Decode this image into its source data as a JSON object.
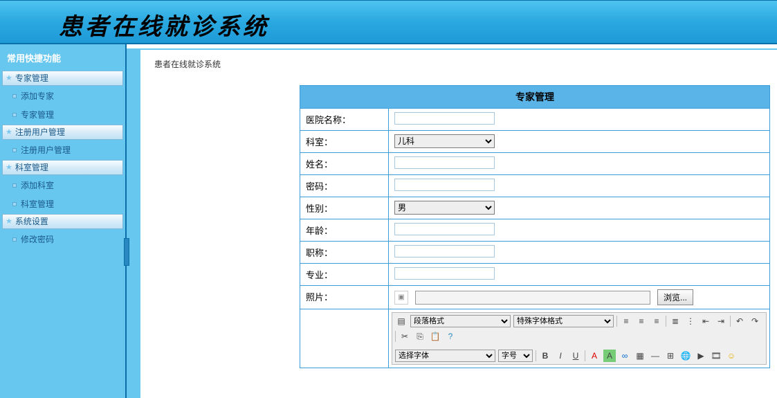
{
  "app": {
    "title": "患者在线就诊系统"
  },
  "sidebar": {
    "heading": "常用快捷功能",
    "groups": [
      {
        "title": "专家管理",
        "items": [
          "添加专家",
          "专家管理"
        ]
      },
      {
        "title": "注册用户管理",
        "items": [
          "注册用户管理"
        ]
      },
      {
        "title": "科室管理",
        "items": [
          "添加科室",
          "科室管理"
        ]
      },
      {
        "title": "系统设置",
        "items": [
          "修改密码"
        ]
      }
    ]
  },
  "breadcrumb": "患者在线就诊系统",
  "panel": {
    "title": "专家管理",
    "labels": {
      "hospital": "医院名称：",
      "department": "科室：",
      "name": "姓名：",
      "password": "密码：",
      "gender": "性别：",
      "age": "年龄：",
      "jobtitle": "职称：",
      "major": "专业：",
      "photo": "照片："
    },
    "values": {
      "hospital": "",
      "department": "儿科",
      "name": "",
      "password": "",
      "gender": "男",
      "age": "",
      "jobtitle": "",
      "major": ""
    },
    "browse_label": "浏览...",
    "editor": {
      "para_format": "段落格式",
      "font_style": "特殊字体格式",
      "font_family": "选择字体",
      "font_size": "字号"
    }
  }
}
